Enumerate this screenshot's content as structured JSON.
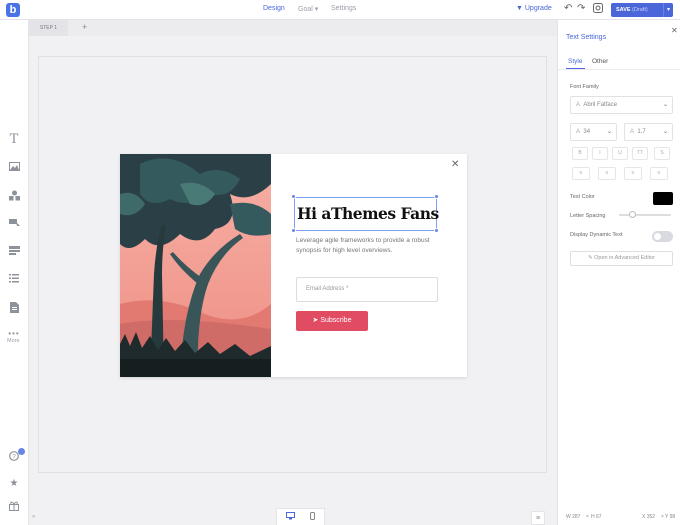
{
  "topbar": {
    "logo": "b",
    "tabs": [
      {
        "label": "Design"
      },
      {
        "label": "Goal ▾"
      },
      {
        "label": "Settings"
      }
    ],
    "upgrade_label": "▼ Upgrade",
    "save_label": "SAVE",
    "save_status": "(Draft)"
  },
  "steps": {
    "tabs": [
      {
        "label": "STEP 1"
      }
    ],
    "add_label": "+"
  },
  "leftbar": {
    "more_label": "More"
  },
  "popup": {
    "close_label": "✕",
    "headline": "Hi aThemes Fans",
    "subtext": "Leverage agile frameworks to provide a robust synopsis for high level overviews.",
    "email_placeholder": "Email Address *",
    "subscribe_label": "Subscribe"
  },
  "panel": {
    "title": "Text Settings",
    "close_label": "✕",
    "tabs": [
      {
        "label": "Style"
      },
      {
        "label": "Other"
      }
    ],
    "font_family_label": "Font Family",
    "font_family_value": "Abril Fatface",
    "font_size": "34",
    "line_height": "1.7",
    "style_buttons": [
      "B",
      "I",
      "U",
      "TT",
      "S"
    ],
    "text_color_label": "Text Color",
    "text_color": "#000000",
    "letter_spacing_label": "Letter Spacing",
    "letter_spacing_level": 0.25,
    "dynamic_text_label": "Display Dynamic Text",
    "dynamic_text_on": false,
    "advanced_label": "Open in Advanced Editor",
    "width_label": "W 287",
    "height_label": "H 67",
    "x_label": "X 352",
    "y_label": "Y 98"
  },
  "colors": {
    "accent": "#4a66d8",
    "subscribe": "#e24c63",
    "illustration_sky": "#f3a39a",
    "illustration_dark": "#2a4046"
  }
}
